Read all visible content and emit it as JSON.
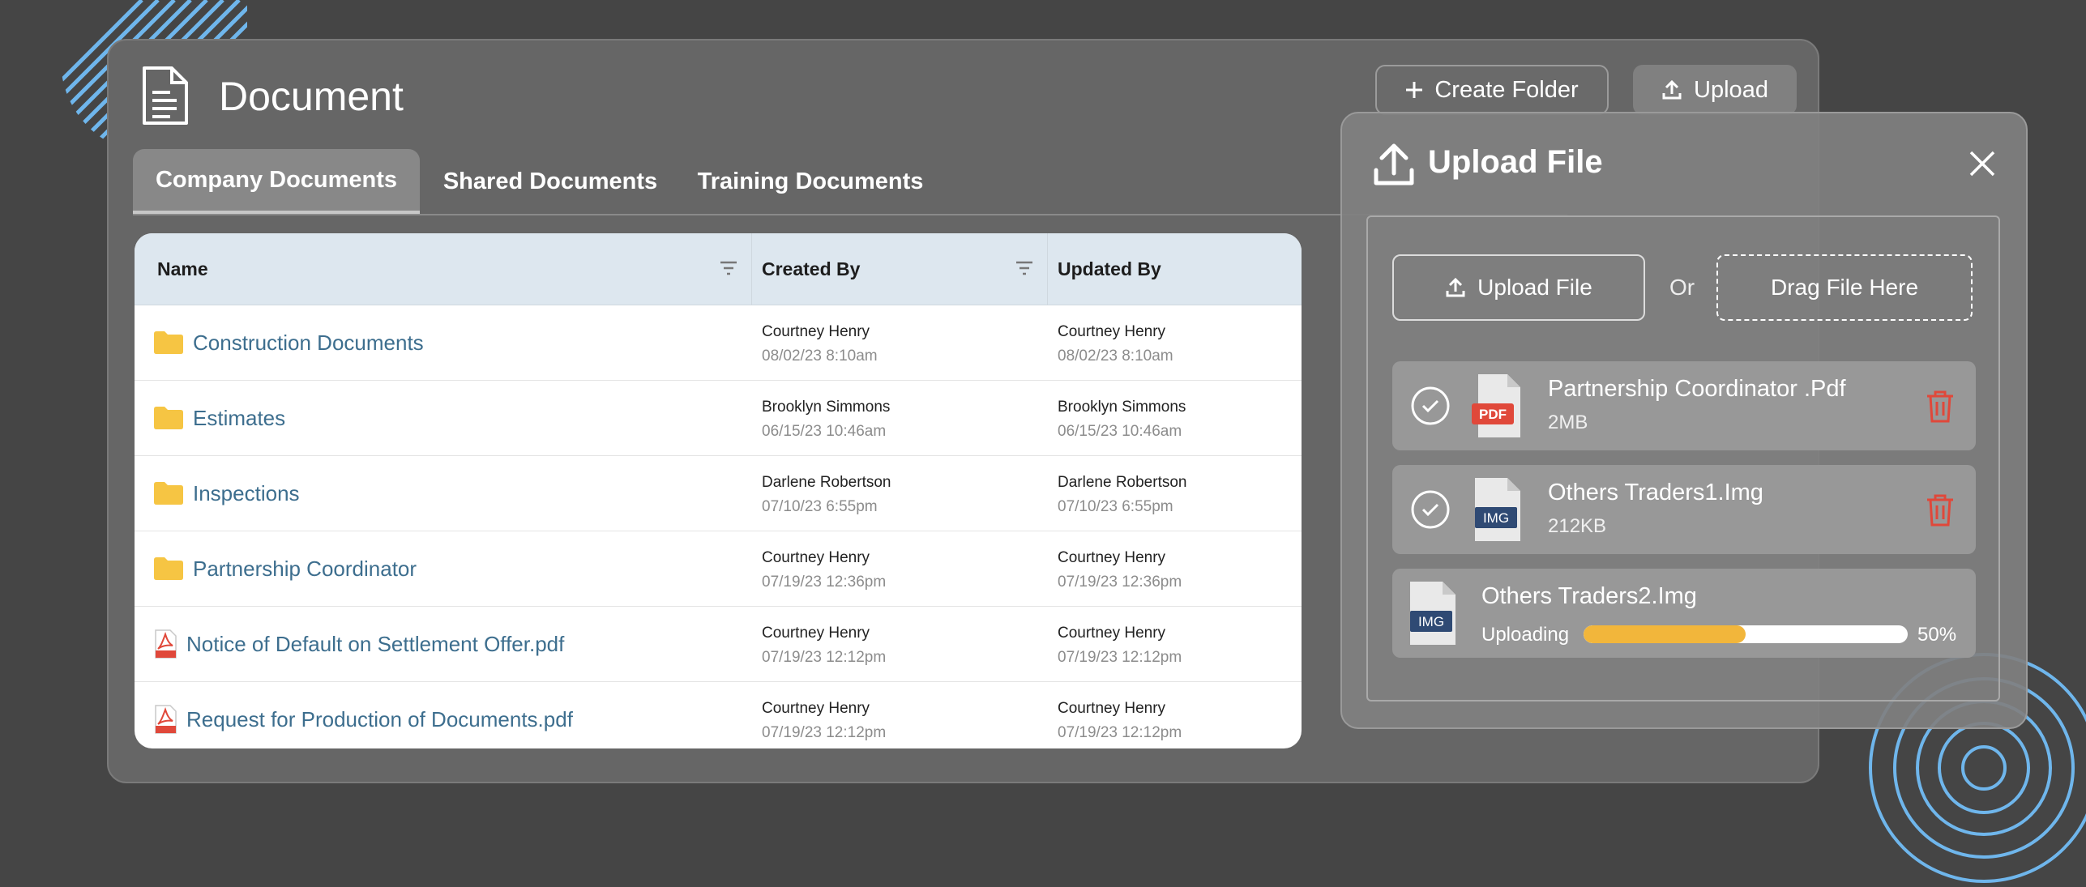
{
  "header": {
    "title": "Document",
    "create_folder_label": "Create Folder",
    "upload_label": "Upload"
  },
  "tabs": [
    {
      "label": "Company Documents",
      "active": true
    },
    {
      "label": "Shared Documents",
      "active": false
    },
    {
      "label": "Training Documents",
      "active": false
    }
  ],
  "table": {
    "columns": [
      "Name",
      "Created By",
      "Updated By"
    ],
    "rows": [
      {
        "type": "folder",
        "name": "Construction Documents",
        "created_by": "Courtney Henry",
        "created_at": "08/02/23 8:10am",
        "updated_by": "Courtney Henry",
        "updated_at": "08/02/23 8:10am"
      },
      {
        "type": "folder",
        "name": "Estimates",
        "created_by": "Brooklyn Simmons",
        "created_at": "06/15/23 10:46am",
        "updated_by": "Brooklyn Simmons",
        "updated_at": "06/15/23 10:46am"
      },
      {
        "type": "folder",
        "name": "Inspections",
        "created_by": "Darlene Robertson",
        "created_at": "07/10/23 6:55pm",
        "updated_by": "Darlene Robertson",
        "updated_at": "07/10/23 6:55pm"
      },
      {
        "type": "folder",
        "name": "Partnership Coordinator",
        "created_by": "Courtney Henry",
        "created_at": "07/19/23 12:36pm",
        "updated_by": "Courtney Henry",
        "updated_at": "07/19/23 12:36pm"
      },
      {
        "type": "pdf",
        "name": "Notice of Default on Settlement Offer.pdf",
        "created_by": "Courtney Henry",
        "created_at": "07/19/23 12:12pm",
        "updated_by": "Courtney Henry",
        "updated_at": "07/19/23 12:12pm"
      },
      {
        "type": "pdf",
        "name": "Request for Production of Documents.pdf",
        "created_by": "Courtney Henry",
        "created_at": "07/19/23 12:12pm",
        "updated_by": "Courtney Henry",
        "updated_at": "07/19/23 12:12pm"
      }
    ]
  },
  "upload_dialog": {
    "title": "Upload File",
    "upload_button_label": "Upload File",
    "or_label": "Or",
    "drop_label": "Drag File Here",
    "files": [
      {
        "name": "Partnership Coordinator .Pdf",
        "size": "2MB",
        "badge": "PDF",
        "status": "done"
      },
      {
        "name": "Others Traders1.Img",
        "size": "212KB",
        "badge": "IMG",
        "status": "done"
      },
      {
        "name": "Others Traders2.Img",
        "badge": "IMG",
        "status": "uploading",
        "status_label": "Uploading",
        "progress": 0.5,
        "progress_label": "50%"
      }
    ]
  },
  "colors": {
    "folder": "#f6c543",
    "link": "#3d6e8e",
    "danger": "#e0483a",
    "progress": "#f2b63b",
    "accent_deco": "#6fb6ec"
  }
}
